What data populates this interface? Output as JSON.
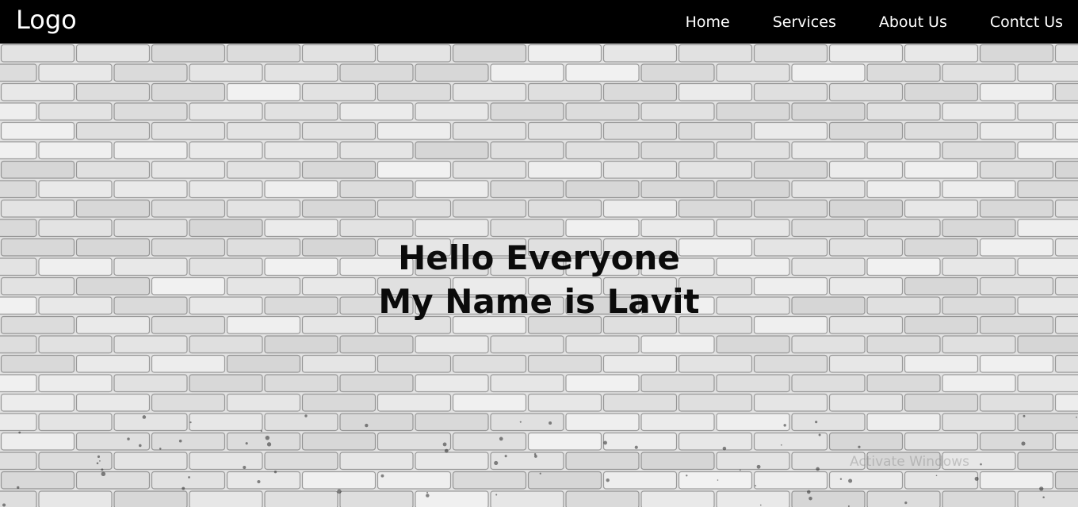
{
  "navbar": {
    "logo": "Logo",
    "links": [
      "Home",
      "Services",
      "About Us",
      "Contct Us"
    ]
  },
  "hero": {
    "line1": "Hello Everyone",
    "line2": "My Name is Lavit"
  },
  "watermark": "Activate Windows",
  "colors": {
    "navbar_bg": "#000000",
    "nav_text": "#ffffff",
    "hero_text": "#0b0b0b",
    "wall": "#dedede"
  }
}
